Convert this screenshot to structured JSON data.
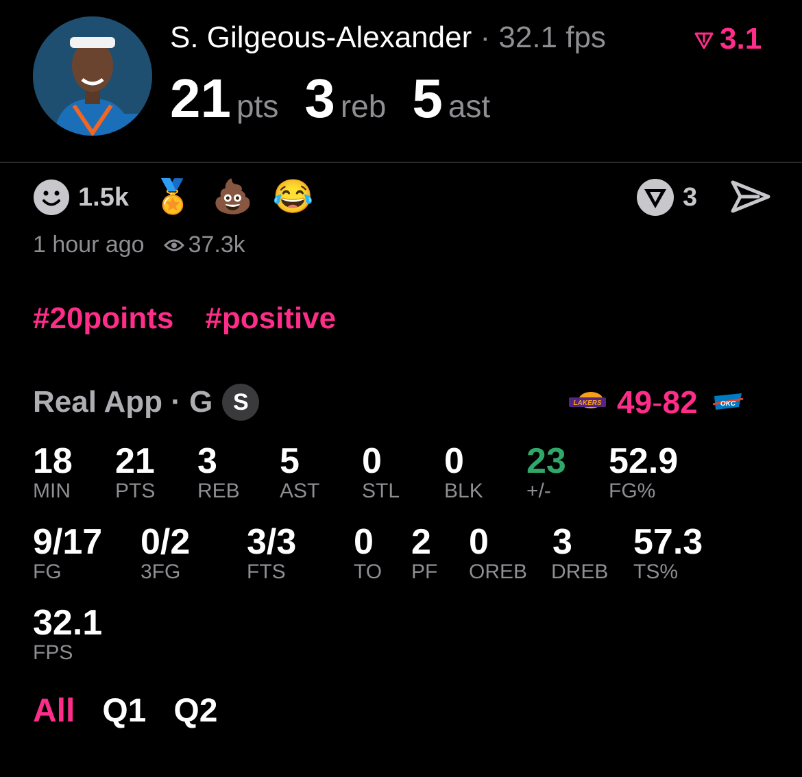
{
  "player": {
    "name": "S. Gilgeous-Alexander",
    "separator": "·",
    "fps": "32.1 fps",
    "rank": "3.1",
    "statline": [
      {
        "value": "21",
        "unit": "pts"
      },
      {
        "value": "3",
        "unit": "reb"
      },
      {
        "value": "5",
        "unit": "ast"
      }
    ]
  },
  "reactions": {
    "count": "1.5k",
    "emojis": [
      "🏅",
      "💩",
      "😂"
    ],
    "vote_count": "3"
  },
  "meta": {
    "time": "1 hour ago",
    "views": "37.3k"
  },
  "hashtags": [
    "#20points",
    "#positive"
  ],
  "game": {
    "label": "Real App · G",
    "badge": "S",
    "away_team": "LAKERS",
    "home_team": "OKC",
    "away_score": "49",
    "dash": "-",
    "home_score": "82"
  },
  "stats": [
    {
      "value": "18",
      "label": "MIN"
    },
    {
      "value": "21",
      "label": "PTS"
    },
    {
      "value": "3",
      "label": "REB"
    },
    {
      "value": "5",
      "label": "AST"
    },
    {
      "value": "0",
      "label": "STL"
    },
    {
      "value": "0",
      "label": "BLK"
    },
    {
      "value": "23",
      "label": "+/-"
    },
    {
      "value": "52.9",
      "label": "FG%"
    },
    {
      "value": "9/17",
      "label": "FG"
    },
    {
      "value": "0/2",
      "label": "3FG"
    },
    {
      "value": "3/3",
      "label": "FTS"
    },
    {
      "value": "0",
      "label": "TO"
    },
    {
      "value": "2",
      "label": "PF"
    },
    {
      "value": "0",
      "label": "OREB"
    },
    {
      "value": "3",
      "label": "DREB"
    },
    {
      "value": "57.3",
      "label": "TS%"
    },
    {
      "value": "32.1",
      "label": "FPS"
    }
  ],
  "tabs": [
    "All",
    "Q1",
    "Q2"
  ],
  "colors": {
    "accent": "#ff2d8a",
    "positive": "#2fa86a",
    "muted": "#8e8e93",
    "background": "#000000"
  }
}
